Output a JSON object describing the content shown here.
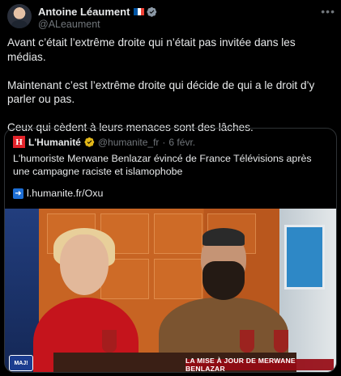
{
  "author": {
    "name": "Antoine Léaument",
    "handle": "@ALeaument",
    "flag_colors": [
      "#0055A4",
      "#FFFFFF",
      "#EF4135"
    ],
    "verified_icon": "verified-badge-icon",
    "more_icon": "more-options-icon"
  },
  "tweet": {
    "paragraphs": [
      "Avant c’était l’extrême droite qui n’était pas invitée dans les médias.",
      "Maintenant c’est l’extrême droite qui décide de qui a le droit d’y parler ou pas.",
      "Ceux qui cèdent à leurs menaces sont des lâches."
    ]
  },
  "quote": {
    "logo_letter": "H",
    "name": "L'Humanité",
    "handle": "@humanite_fr",
    "separator": "·",
    "date": "6 févr.",
    "text": "L'humoriste Merwane Benlazar évincé de France Télévisions après une campagne raciste et islamophobe",
    "link": "l.humanite.fr/Oxu",
    "media": {
      "channel_logo": "MAJ!",
      "banner": "LA MISE À JOUR DE MERWANE BENLAZAR"
    }
  },
  "colors": {
    "background": "#000000",
    "text": "#e7e9ea",
    "muted": "#71767b",
    "verified_blue": "#1d9bf0",
    "gold_badge": "#e2b719",
    "humanite_red": "#e2232a"
  }
}
